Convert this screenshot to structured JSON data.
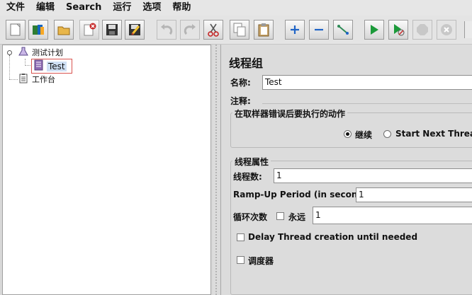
{
  "menu": [
    "文件",
    "编辑",
    "Search",
    "运行",
    "选项",
    "帮助"
  ],
  "toolbar": {
    "buttons": [
      "new-icon",
      "templates-icon",
      "open-icon",
      "close-icon",
      "save-icon",
      "save-as-icon",
      "undo-icon",
      "redo-icon",
      "cut-icon",
      "copy-icon",
      "paste-icon",
      "expand-icon",
      "collapse-icon",
      "toggle-icon",
      "start-icon",
      "start-no-pause-icon",
      "stop-icon",
      "shutdown-icon"
    ]
  },
  "tree": {
    "test_plan": "测试计划",
    "thread_group": "Test",
    "workbench": "工作台"
  },
  "panel": {
    "title": "线程组",
    "name_label": "名称:",
    "name_value": "Test",
    "comment_label": "注释:",
    "error_group_title": "在取样器错误后要执行的动作",
    "radio_continue": "继续",
    "radio_next_loop": "Start Next Thread L",
    "props_group_title": "线程属性",
    "threads_label": "线程数:",
    "threads_value": "1",
    "rampup_label": "Ramp-Up Period (in seconds):",
    "rampup_value": "1",
    "loop_label": "循环次数",
    "forever_label": "永远",
    "loop_value": "1",
    "delay_label": "Delay Thread creation until needed",
    "scheduler_label": "调度器"
  },
  "colors": {
    "accent_selection": "#cfe0f4",
    "selection_border": "#d9534f"
  }
}
